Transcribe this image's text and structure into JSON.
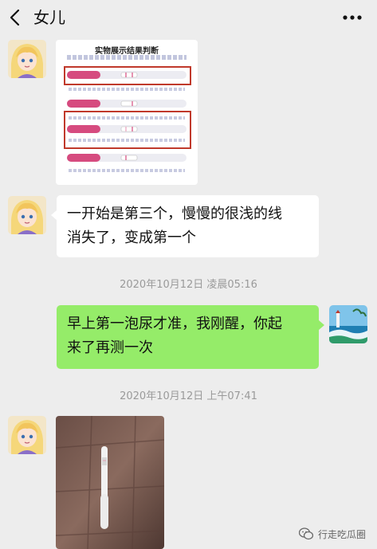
{
  "header": {
    "title": "女儿"
  },
  "messages": {
    "image_card": {
      "title": "实物展示结果判断"
    },
    "text1": {
      "line1": "一开始是第三个，慢慢的很浅的线",
      "line2": "消失了，变成第一个"
    },
    "time1": "2020年10月12日 凌晨05:16",
    "text2": {
      "line1": "早上第一泡尿才准，我刚醒，你起",
      "line2": "来了再测一次"
    },
    "time2": "2020年10月12日 上午07:41"
  },
  "watermark": {
    "text": "行走吃瓜圈"
  },
  "colors": {
    "background": "#ededed",
    "sent_bubble": "#95ec69",
    "received_bubble": "#ffffff",
    "timestamp": "#9a9a9a"
  }
}
